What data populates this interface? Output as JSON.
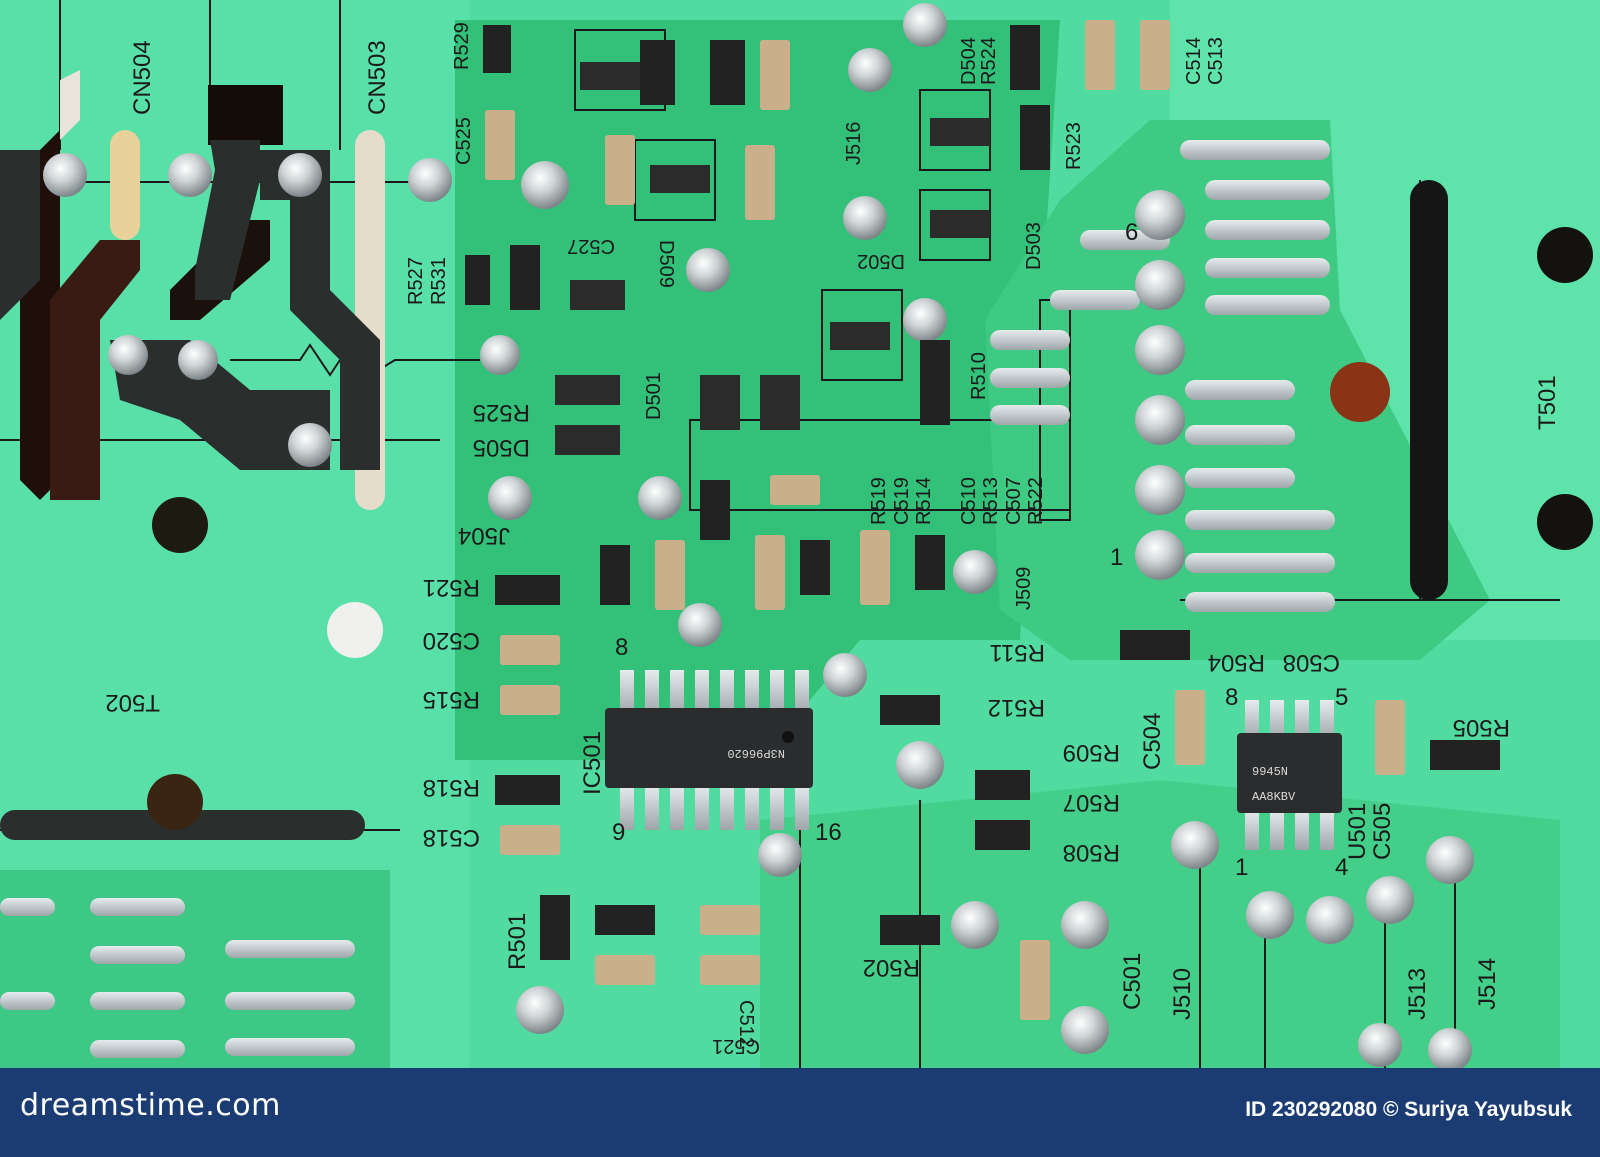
{
  "footer": {
    "brand": "dreamstime.com",
    "credit": "ID 230292080 © Suriya Yayubsuk"
  },
  "board": {
    "labels_upright": [
      "CN504",
      "CN503",
      "R529",
      "C525",
      "R527",
      "R531",
      "C527",
      "D509",
      "J516",
      "D502",
      "D504",
      "R524",
      "R523",
      "C514",
      "C513",
      "D503",
      "R510",
      "D501",
      "D505",
      "R525",
      "J504",
      "R521",
      "C520",
      "R515",
      "C518",
      "R518",
      "R519",
      "C519",
      "R514",
      "C510",
      "R513",
      "C507",
      "R522",
      "J509",
      "R511",
      "R512",
      "R509",
      "R507",
      "R508",
      "C508",
      "R504",
      "C504",
      "C505",
      "R505",
      "U501",
      "R501",
      "R502",
      "C501",
      "J510",
      "J513",
      "J514",
      "T501",
      "T502",
      "IC501",
      "C512",
      "C521"
    ],
    "chip1_marking": "N3P96620",
    "chip2_marking_line1": "9945N",
    "chip2_marking_line2": "AA8KBV",
    "pin_numbers": [
      "8",
      "9",
      "16",
      "8",
      "5",
      "1",
      "4",
      "6",
      "1"
    ]
  }
}
